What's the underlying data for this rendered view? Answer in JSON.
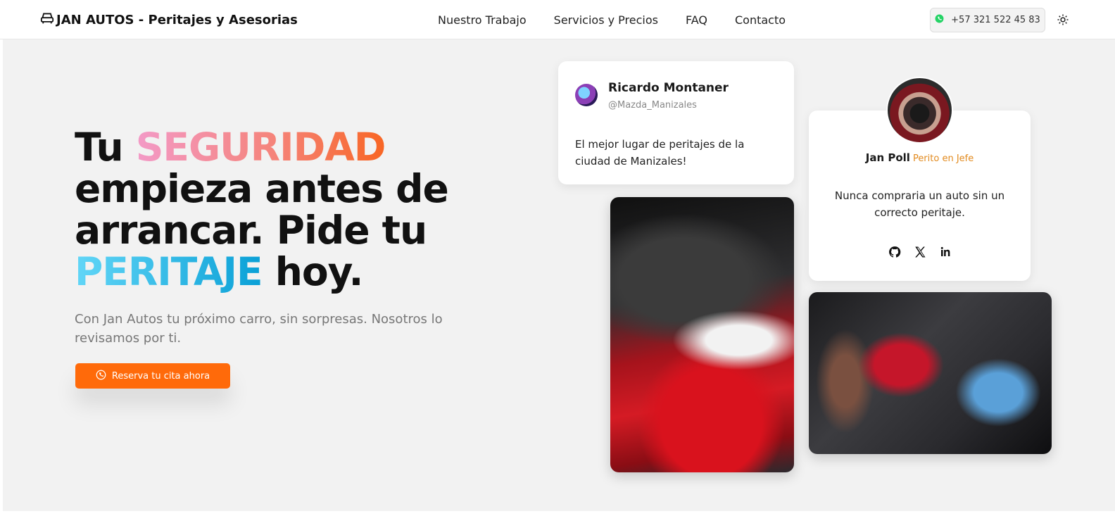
{
  "nav": {
    "brand": "JAN AUTOS - Peritajes y Asesorias",
    "brand_icon": "car-icon",
    "links": [
      "Nuestro Trabajo",
      "Servicios y Precios",
      "FAQ",
      "Contacto"
    ],
    "phone": "+57 321 522 45 83",
    "phone_icon": "whatsapp-icon",
    "theme_icon": "sun-icon"
  },
  "hero": {
    "headline": {
      "part1": "Tu ",
      "highlight1": "SEGURIDAD",
      "part2": " empieza antes de arrancar. Pide tu ",
      "highlight2": "PERITAJE",
      "part3": " hoy."
    },
    "subtitle": "Con Jan Autos tu próximo carro, sin sorpresas. Nosotros lo revisamos por ti.",
    "cta_label": "Reserva tu cita ahora",
    "cta_icon": "whatsapp-icon"
  },
  "review": {
    "name": "Ricardo Montaner",
    "handle": "@Mazda_Manizales",
    "text": "El mejor lugar de peritajes de la ciudad de Manizales!"
  },
  "profile": {
    "name": "Jan Poll",
    "role": "Perito en Jefe",
    "quote": "Nunca compraria un auto sin un correcto peritaje.",
    "social_icons": [
      "github-icon",
      "x-icon",
      "linkedin-icon"
    ]
  },
  "colors": {
    "accent": "#ff6a0a",
    "role": "#e28a1e",
    "grad_seguridad": [
      "#f39ac7",
      "#f86624"
    ],
    "grad_peritaje": [
      "#62d6f7",
      "#0aa0d6"
    ],
    "whatsapp": "#25d366"
  }
}
